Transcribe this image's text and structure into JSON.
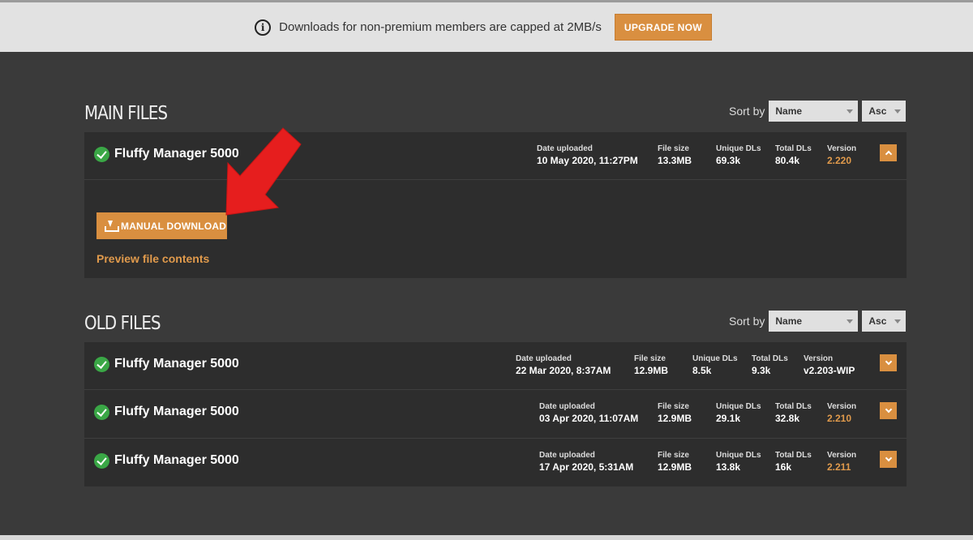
{
  "banner": {
    "text": "Downloads for non-premium members are capped at 2MB/s",
    "upgrade_label": "UPGRADE NOW"
  },
  "main_files": {
    "title": "MAIN FILES",
    "sort_label": "Sort by",
    "sort_value": "Name",
    "order_value": "Asc",
    "files": [
      {
        "name": "Fluffy Manager 5000",
        "date_label": "Date uploaded",
        "date": "10 May 2020, 11:27PM",
        "size_label": "File size",
        "size": "13.3MB",
        "unique_label": "Unique DLs",
        "unique": "69.3k",
        "total_label": "Total DLs",
        "total": "80.4k",
        "version_label": "Version",
        "version": "2.220"
      }
    ],
    "manual_download_label": "MANUAL DOWNLOAD",
    "preview_label": "Preview file contents"
  },
  "old_files": {
    "title": "OLD FILES",
    "sort_label": "Sort by",
    "sort_value": "Name",
    "order_value": "Asc",
    "files": [
      {
        "name": "Fluffy Manager 5000",
        "date_label": "Date uploaded",
        "date": "22 Mar 2020, 8:37AM",
        "size_label": "File size",
        "size": "12.9MB",
        "unique_label": "Unique DLs",
        "unique": "8.5k",
        "total_label": "Total DLs",
        "total": "9.3k",
        "version_label": "Version",
        "version": "v2.203-WIP"
      },
      {
        "name": "Fluffy Manager 5000",
        "date_label": "Date uploaded",
        "date": "03 Apr 2020, 11:07AM",
        "size_label": "File size",
        "size": "12.9MB",
        "unique_label": "Unique DLs",
        "unique": "29.1k",
        "total_label": "Total DLs",
        "total": "32.8k",
        "version_label": "Version",
        "version": "2.210"
      },
      {
        "name": "Fluffy Manager 5000",
        "date_label": "Date uploaded",
        "date": "17 Apr 2020, 5:31AM",
        "size_label": "File size",
        "size": "12.9MB",
        "unique_label": "Unique DLs",
        "unique": "13.8k",
        "total_label": "Total DLs",
        "total": "16k",
        "version_label": "Version",
        "version": "2.211"
      }
    ]
  },
  "colors": {
    "accent": "#d98f40",
    "background": "#3a3a3a",
    "row": "#2d2d2d",
    "annotation_arrow": "#e61e1e",
    "check": "#3aa746"
  },
  "icons": [
    "info-icon",
    "check-icon",
    "chevron-up-icon",
    "chevron-down-icon",
    "download-icon",
    "red-arrow-icon"
  ]
}
